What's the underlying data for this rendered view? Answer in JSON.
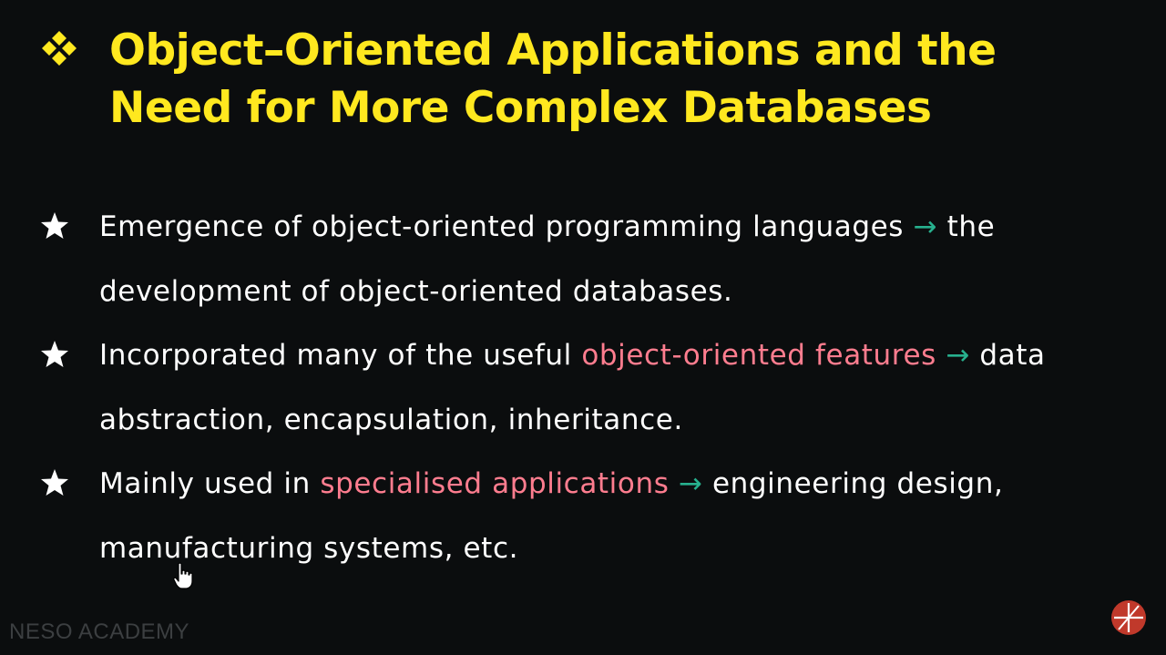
{
  "slide": {
    "title_icon": "diamond-cluster-icon",
    "title": "Object–Oriented Applications and the Need for More Complex Databases",
    "bullet_icon": "star-icon",
    "bullets": [
      {
        "pre": "Emergence of object-oriented programming languages",
        "highlight": "",
        "arrow": "→",
        "post": "the development of object-oriented databases."
      },
      {
        "pre": "Incorporated many of the useful",
        "highlight": "object-oriented features",
        "arrow": "→",
        "post": "data abstraction, encapsulation, inheritance."
      },
      {
        "pre": "Mainly used in",
        "highlight": "specialised applications",
        "arrow": "→",
        "post": "engineering design, manufacturing systems, etc."
      }
    ]
  },
  "footer": {
    "brand": "NESO ACADEMY",
    "logo_icon": "neso-logo-icon"
  },
  "cursor_icon": "hand-pointer-icon",
  "colors": {
    "background": "#0b0d0e",
    "title": "#ffe81f",
    "body_text": "#ffffff",
    "highlight": "#ff7d8f",
    "arrow": "#27b08e",
    "brand_text": "#3c3f41",
    "logo": "#c0392b"
  }
}
